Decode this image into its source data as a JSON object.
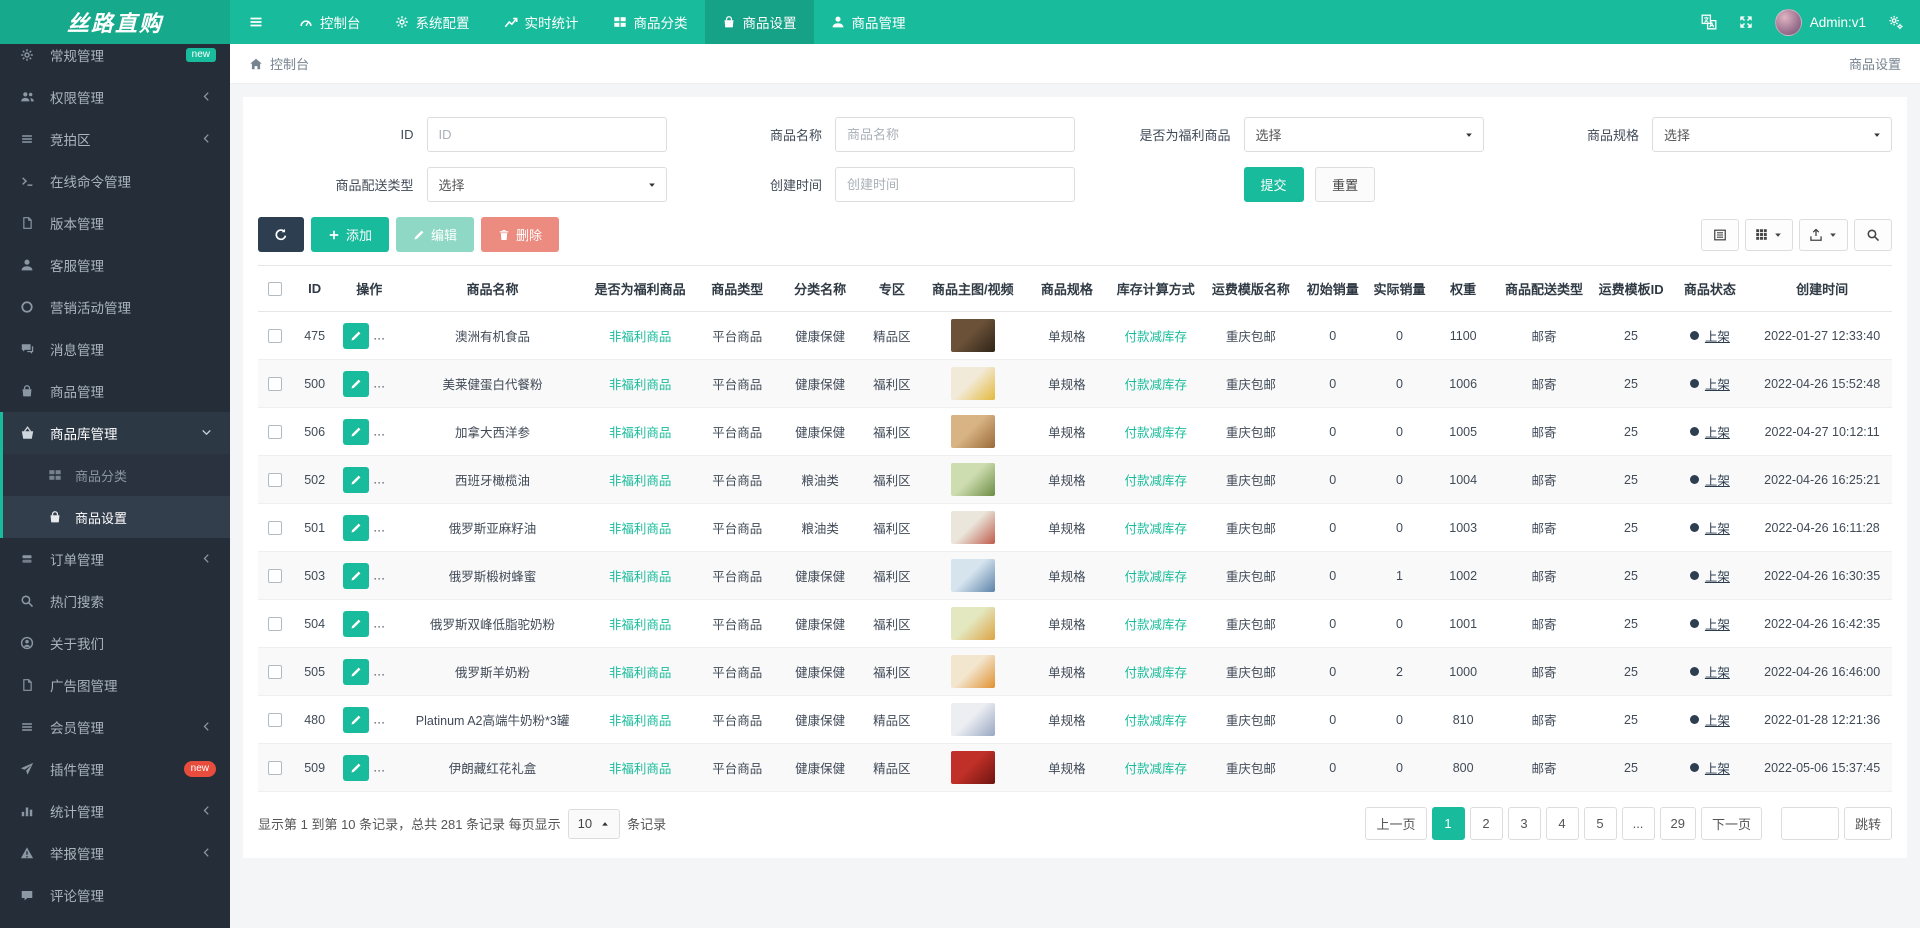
{
  "navbar": {
    "brand": "丝路直购",
    "items": [
      {
        "label": "控制台",
        "icon": "dashboard",
        "active": false
      },
      {
        "label": "系统配置",
        "icon": "gear",
        "active": false
      },
      {
        "label": "实时统计",
        "icon": "chart-line",
        "active": false
      },
      {
        "label": "商品分类",
        "icon": "th-large",
        "active": false
      },
      {
        "label": "商品设置",
        "icon": "bag",
        "active": true
      },
      {
        "label": "商品管理",
        "icon": "user",
        "active": false
      }
    ],
    "user_name": "Admin:v1",
    "right_icons": [
      "translate-icon",
      "fullscreen-icon",
      "gears-icon"
    ]
  },
  "sidebar": {
    "items": [
      {
        "label": "常规管理",
        "icon": "gear",
        "badge": "new",
        "badge_style": "teal"
      },
      {
        "label": "权限管理",
        "icon": "users",
        "arrow": true
      },
      {
        "label": "竞拍区",
        "icon": "list",
        "arrow": true
      },
      {
        "label": "在线命令管理",
        "icon": "terminal"
      },
      {
        "label": "版本管理",
        "icon": "file"
      },
      {
        "label": "客服管理",
        "icon": "user"
      },
      {
        "label": "营销活动管理",
        "icon": "circle"
      },
      {
        "label": "消息管理",
        "icon": "comments"
      },
      {
        "label": "商品管理",
        "icon": "bag"
      },
      {
        "label": "商品库管理",
        "icon": "basket",
        "expanded": true,
        "children": [
          {
            "label": "商品分类",
            "icon": "th-large",
            "active": false
          },
          {
            "label": "商品设置",
            "icon": "bag",
            "active": true
          }
        ]
      },
      {
        "label": "订单管理",
        "icon": "cards",
        "arrow": true
      },
      {
        "label": "热门搜索",
        "icon": "search"
      },
      {
        "label": "关于我们",
        "icon": "user-circle"
      },
      {
        "label": "广告图管理",
        "icon": "file"
      },
      {
        "label": "会员管理",
        "icon": "list",
        "arrow": true
      },
      {
        "label": "插件管理",
        "icon": "plane",
        "badge": "new",
        "badge_style": "red"
      },
      {
        "label": "统计管理",
        "icon": "bar-chart",
        "arrow": true
      },
      {
        "label": "举报管理",
        "icon": "warning",
        "arrow": true
      },
      {
        "label": "评论管理",
        "icon": "comment"
      }
    ]
  },
  "breadcrumb": {
    "left": "控制台",
    "right": "商品设置"
  },
  "filters": {
    "fields": [
      {
        "label": "ID",
        "type": "input",
        "placeholder": "ID"
      },
      {
        "label": "商品名称",
        "type": "input",
        "placeholder": "商品名称"
      },
      {
        "label": "是否为福利商品",
        "type": "select",
        "value": "选择"
      },
      {
        "label": "商品规格",
        "type": "select",
        "value": "选择"
      },
      {
        "label": "商品配送类型",
        "type": "select",
        "value": "选择"
      },
      {
        "label": "创建时间",
        "type": "input",
        "placeholder": "创建时间"
      }
    ],
    "submit_label": "提交",
    "reset_label": "重置"
  },
  "toolbar": {
    "add_label": "添加",
    "edit_label": "编辑",
    "delete_label": "删除"
  },
  "table": {
    "columns": [
      "ID",
      "操作",
      "商品名称",
      "是否为福利商品",
      "商品类型",
      "分类名称",
      "专区",
      "商品主图/视频",
      "商品规格",
      "库存计算方式",
      "运费模版名称",
      "初始销量",
      "实际销量",
      "权重",
      "商品配送类型",
      "运费模板ID",
      "商品状态",
      "创建时间"
    ],
    "rows": [
      {
        "id": "475",
        "name": "澳洲有机食品",
        "welfare": "非福利商品",
        "goods_type": "平台商品",
        "category": "健康保健",
        "zone": "精品区",
        "image": [
          "#6b5138",
          "#2f2418"
        ],
        "spec": "单规格",
        "stock_mode": "付款减库存",
        "freight_name": "重庆包邮",
        "init_sales": "0",
        "real_sales": "0",
        "weight": "1100",
        "delivery": "邮寄",
        "freight_id": "25",
        "status": "上架",
        "created": "2022-01-27 12:33:40"
      },
      {
        "id": "500",
        "name": "美莱健蛋白代餐粉",
        "welfare": "非福利商品",
        "goods_type": "平台商品",
        "category": "健康保健",
        "zone": "福利区",
        "image": [
          "#f2ead8",
          "#e3b93c"
        ],
        "spec": "单规格",
        "stock_mode": "付款减库存",
        "freight_name": "重庆包邮",
        "init_sales": "0",
        "real_sales": "0",
        "weight": "1006",
        "delivery": "邮寄",
        "freight_id": "25",
        "status": "上架",
        "created": "2022-04-26 15:52:48"
      },
      {
        "id": "506",
        "name": "加拿大西洋参",
        "welfare": "非福利商品",
        "goods_type": "平台商品",
        "category": "健康保健",
        "zone": "福利区",
        "image": [
          "#d8b384",
          "#9a6a38"
        ],
        "spec": "单规格",
        "stock_mode": "付款减库存",
        "freight_name": "重庆包邮",
        "init_sales": "0",
        "real_sales": "0",
        "weight": "1005",
        "delivery": "邮寄",
        "freight_id": "25",
        "status": "上架",
        "created": "2022-04-27 10:12:11"
      },
      {
        "id": "502",
        "name": "西班牙橄榄油",
        "welfare": "非福利商品",
        "goods_type": "平台商品",
        "category": "粮油类",
        "zone": "福利区",
        "image": [
          "#cdddb0",
          "#6d8c44"
        ],
        "spec": "单规格",
        "stock_mode": "付款减库存",
        "freight_name": "重庆包邮",
        "init_sales": "0",
        "real_sales": "0",
        "weight": "1004",
        "delivery": "邮寄",
        "freight_id": "25",
        "status": "上架",
        "created": "2022-04-26 16:25:21"
      },
      {
        "id": "501",
        "name": "俄罗斯亚麻籽油",
        "welfare": "非福利商品",
        "goods_type": "平台商品",
        "category": "粮油类",
        "zone": "福利区",
        "image": [
          "#eae6dc",
          "#bf5a4a"
        ],
        "spec": "单规格",
        "stock_mode": "付款减库存",
        "freight_name": "重庆包邮",
        "init_sales": "0",
        "real_sales": "0",
        "weight": "1003",
        "delivery": "邮寄",
        "freight_id": "25",
        "status": "上架",
        "created": "2022-04-26 16:11:28"
      },
      {
        "id": "503",
        "name": "俄罗斯椴树蜂蜜",
        "welfare": "非福利商品",
        "goods_type": "平台商品",
        "category": "健康保健",
        "zone": "福利区",
        "image": [
          "#d6e4ee",
          "#5b82a8"
        ],
        "spec": "单规格",
        "stock_mode": "付款减库存",
        "freight_name": "重庆包邮",
        "init_sales": "0",
        "real_sales": "1",
        "weight": "1002",
        "delivery": "邮寄",
        "freight_id": "25",
        "status": "上架",
        "created": "2022-04-26 16:30:35"
      },
      {
        "id": "504",
        "name": "俄罗斯双峰低脂驼奶粉",
        "welfare": "非福利商品",
        "goods_type": "平台商品",
        "category": "健康保健",
        "zone": "福利区",
        "image": [
          "#e4e8c0",
          "#dca343"
        ],
        "spec": "单规格",
        "stock_mode": "付款减库存",
        "freight_name": "重庆包邮",
        "init_sales": "0",
        "real_sales": "0",
        "weight": "1001",
        "delivery": "邮寄",
        "freight_id": "25",
        "status": "上架",
        "created": "2022-04-26 16:42:35"
      },
      {
        "id": "505",
        "name": "俄罗斯羊奶粉",
        "welfare": "非福利商品",
        "goods_type": "平台商品",
        "category": "健康保健",
        "zone": "福利区",
        "image": [
          "#f3e6cf",
          "#e0912f"
        ],
        "spec": "单规格",
        "stock_mode": "付款减库存",
        "freight_name": "重庆包邮",
        "init_sales": "0",
        "real_sales": "2",
        "weight": "1000",
        "delivery": "邮寄",
        "freight_id": "25",
        "status": "上架",
        "created": "2022-04-26 16:46:00"
      },
      {
        "id": "480",
        "name": "Platinum A2高端牛奶粉*3罐",
        "welfare": "非福利商品",
        "goods_type": "平台商品",
        "category": "健康保健",
        "zone": "精品区",
        "image": [
          "#eceef2",
          "#98a7c2"
        ],
        "spec": "单规格",
        "stock_mode": "付款减库存",
        "freight_name": "重庆包邮",
        "init_sales": "0",
        "real_sales": "0",
        "weight": "810",
        "delivery": "邮寄",
        "freight_id": "25",
        "status": "上架",
        "created": "2022-01-28 12:21:36"
      },
      {
        "id": "509",
        "name": "伊朗藏红花礼盒",
        "welfare": "非福利商品",
        "goods_type": "平台商品",
        "category": "健康保健",
        "zone": "精品区",
        "image": [
          "#c03028",
          "#6e1410"
        ],
        "spec": "单规格",
        "stock_mode": "付款减库存",
        "freight_name": "重庆包邮",
        "init_sales": "0",
        "real_sales": "0",
        "weight": "800",
        "delivery": "邮寄",
        "freight_id": "25",
        "status": "上架",
        "created": "2022-05-06 15:37:45"
      }
    ]
  },
  "pagination": {
    "info_prefix": "显示第 1 到第 10 条记录，总共 281 条记录 每页显示",
    "page_size": "10",
    "info_suffix": "条记录",
    "prev_label": "上一页",
    "next_label": "下一页",
    "pages": [
      "1",
      "2",
      "3",
      "4",
      "5",
      "...",
      "29"
    ],
    "active_page": "1",
    "jump_label": "跳转"
  },
  "colors": {
    "accent": "#18bc9c",
    "navy": "#2c3e50",
    "danger": "#e74c3c",
    "sidebar_bg": "#252e38"
  }
}
